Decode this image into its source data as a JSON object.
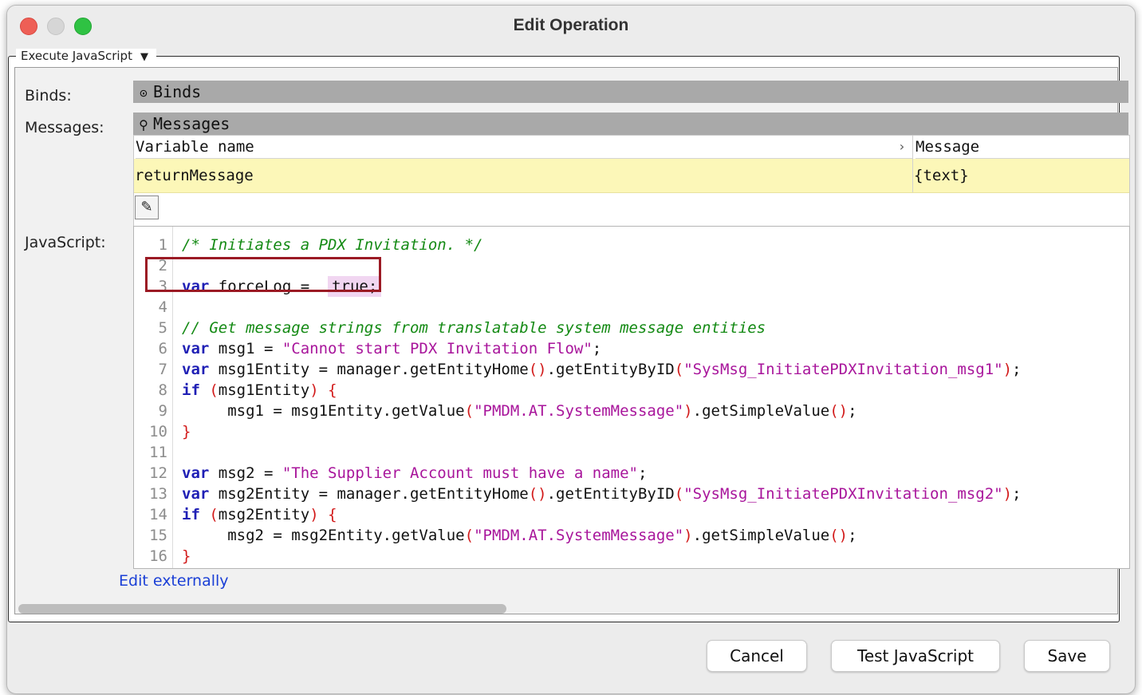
{
  "window": {
    "title": "Edit Operation"
  },
  "group": {
    "title": "Execute JavaScript",
    "caret": "▼"
  },
  "labels": {
    "binds": "Binds:",
    "messages": "Messages:",
    "javascript": "JavaScript:"
  },
  "binds_bar": {
    "icon": "⊙",
    "label": "Binds",
    "icon_name": "key-icon"
  },
  "messages_bar": {
    "icon": "⚲",
    "label": "Messages",
    "icon_name": "pin-icon"
  },
  "table": {
    "columns": [
      "Variable name",
      "Message"
    ],
    "sort_indicator": "›",
    "rows": [
      {
        "variable": "returnMessage",
        "message": "{text}"
      }
    ],
    "edit_icon": "✎"
  },
  "editor": {
    "line_numbers": [
      "1",
      "2",
      "3",
      "4",
      "5",
      "6",
      "7",
      "8",
      "9",
      "10",
      "11",
      "12",
      "13",
      "14",
      "15",
      "16"
    ],
    "highlight_color": "#9b1a24"
  },
  "edit_externally": "Edit externally",
  "buttons": {
    "cancel": "Cancel",
    "test": "Test JavaScript",
    "save": "Save"
  },
  "colors": {
    "keyword": "#1f1fb5",
    "comment": "#148a14",
    "string": "#a8159b",
    "link": "#1a3fd6",
    "row_highlight": "#fcf7b8"
  }
}
